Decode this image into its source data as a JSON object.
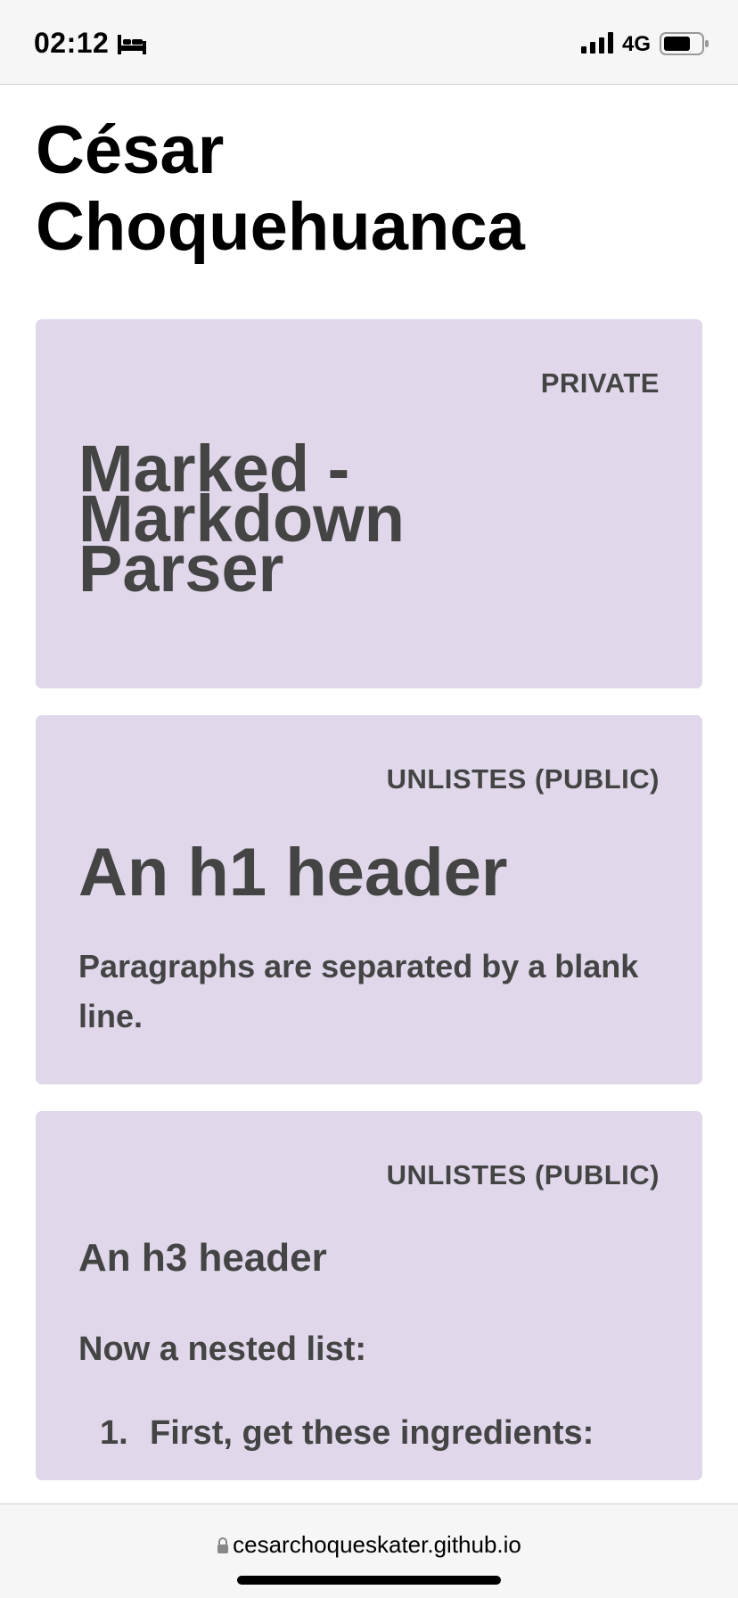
{
  "status_bar": {
    "time": "02:12",
    "network": "4G",
    "icons": [
      "bed-icon",
      "signal-icon",
      "battery-icon"
    ]
  },
  "page": {
    "title": "César Choquehuanca"
  },
  "cards": [
    {
      "visibility": "PRIVATE",
      "heading": "Marked - Markdown Parser"
    },
    {
      "visibility": "UNLISTES (PUBLIC)",
      "heading": "An h1 header",
      "paragraph": "Paragraphs are separated by a blank line."
    },
    {
      "visibility": "UNLISTES (PUBLIC)",
      "heading": "An h3 header",
      "paragraph": "Now a nested list:",
      "list_number": "1.",
      "list_item": "First, get these ingredients:"
    }
  ],
  "browser": {
    "url": "cesarchoqueskater.github.io"
  },
  "colors": {
    "card_background": "#e0d8ea",
    "card_text": "#444444"
  }
}
